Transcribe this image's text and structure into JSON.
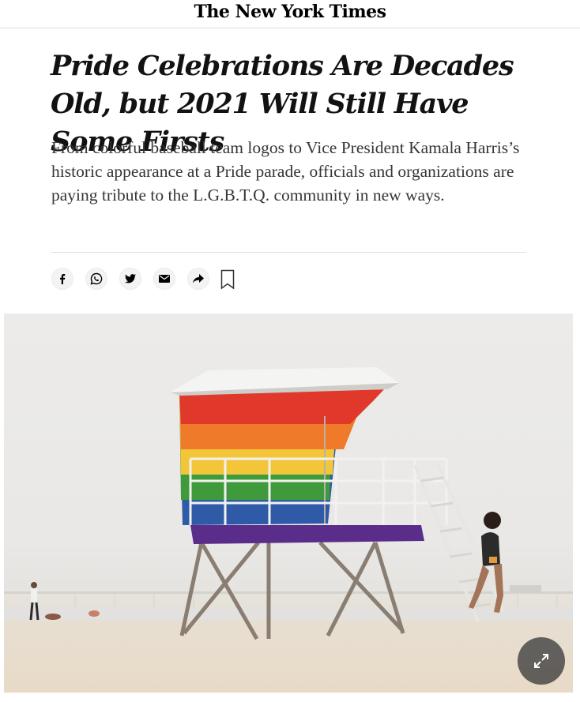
{
  "masthead": {
    "logo_text": "The New York Times"
  },
  "article": {
    "headline": "Pride Celebrations Are Decades Old, but 2021 Will Still Have Some Firsts",
    "summary": "From colorful baseball team logos to Vice President Kamala Harris’s historic appearance at a Pride parade, officials and organizations are paying tribute to the L.G.B.T.Q. community in new ways."
  },
  "share": {
    "icons": [
      "facebook-icon",
      "whatsapp-icon",
      "twitter-icon",
      "email-icon",
      "share-more-icon",
      "bookmark-icon"
    ]
  },
  "photo": {
    "description_icon": "expand-icon",
    "rainbow_colors": [
      "#e0392b",
      "#ee7a2a",
      "#f3c63a",
      "#3f9a3c",
      "#2f5aa8",
      "#5b2d8a"
    ]
  }
}
